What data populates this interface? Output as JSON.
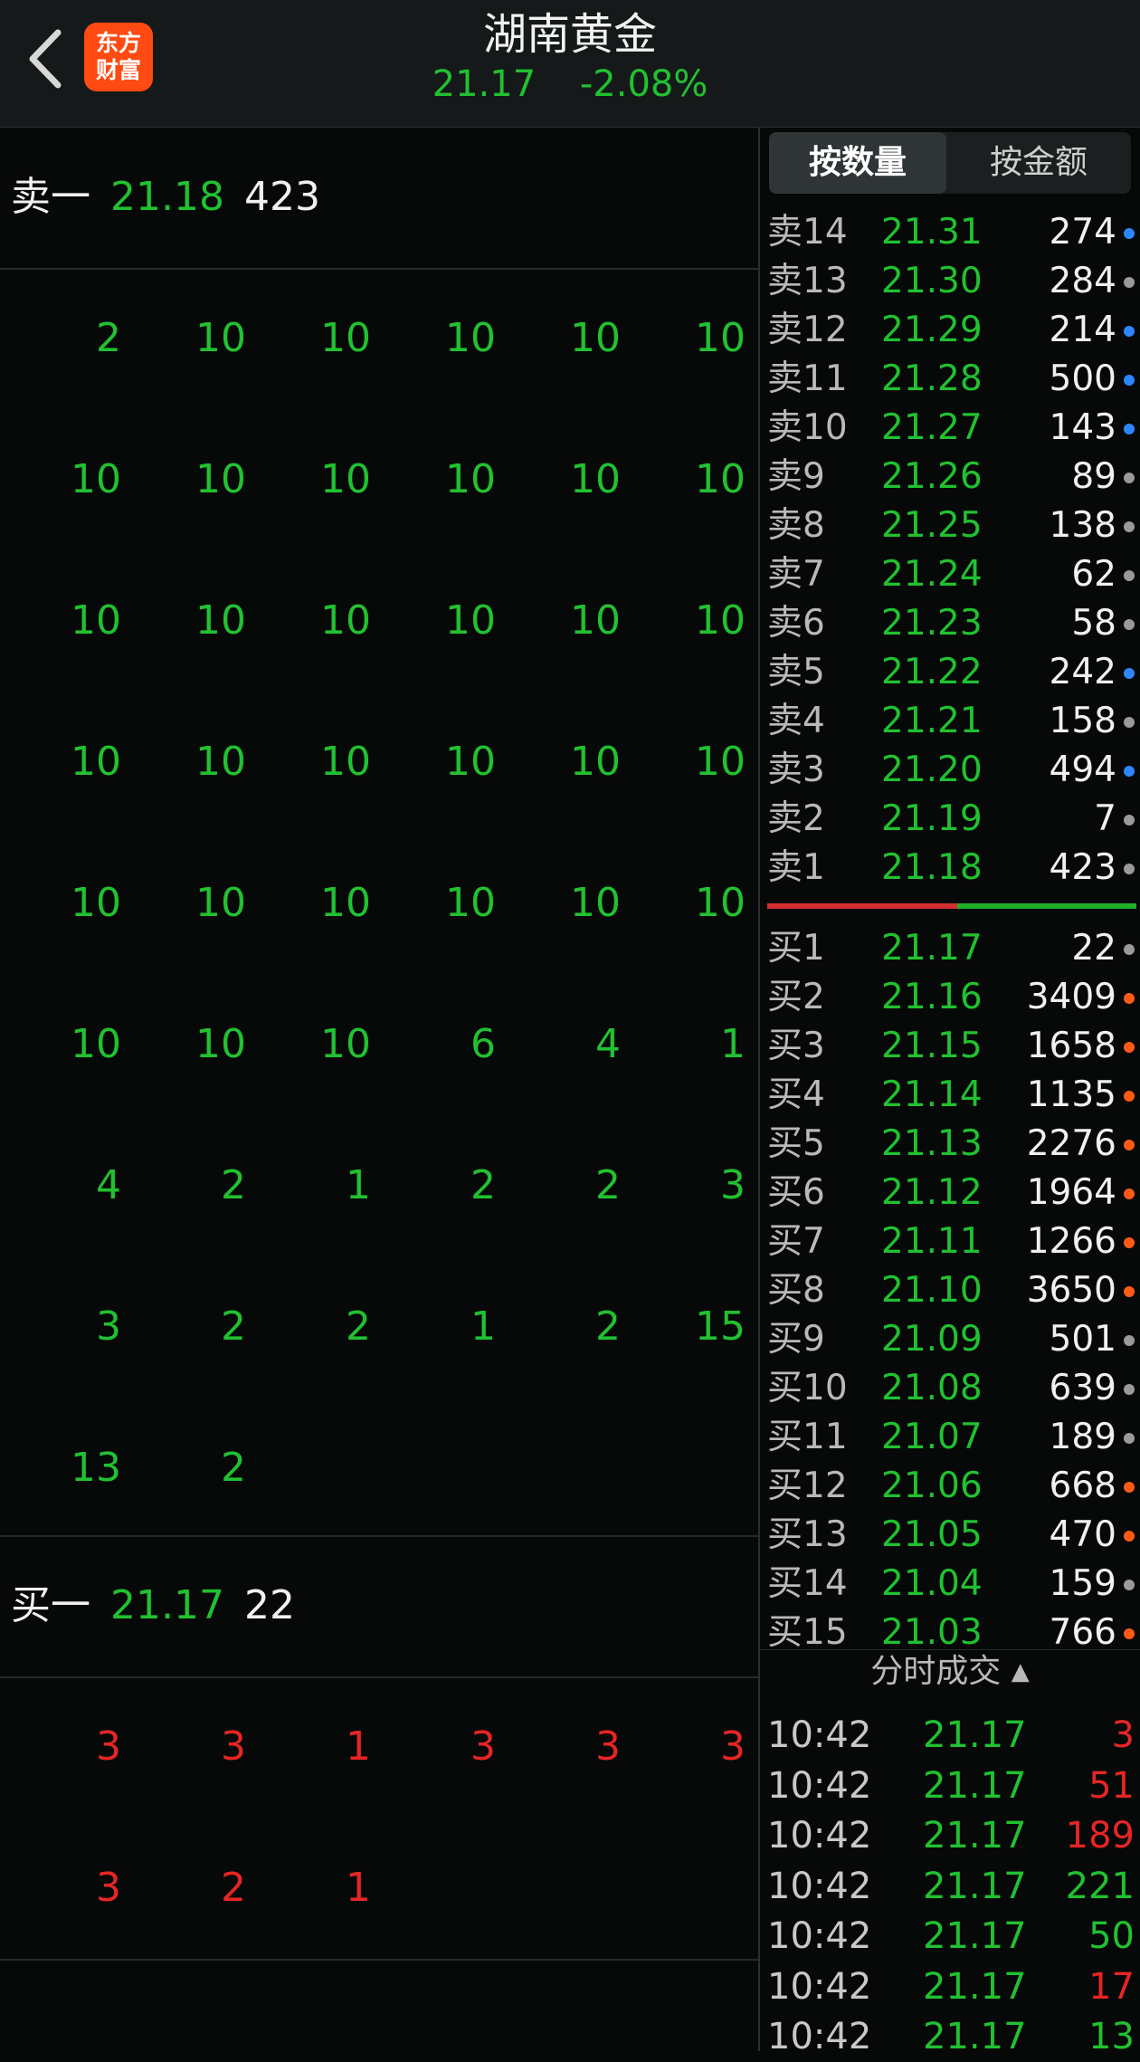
{
  "header": {
    "title": "湖南黄金",
    "price": "21.17",
    "change": "-2.08%",
    "logo_line1": "东方",
    "logo_line2": "财富"
  },
  "left_panel": {
    "ask1": {
      "label": "卖一",
      "price": "21.18",
      "qty": "423"
    },
    "bid1": {
      "label": "买一",
      "price": "21.17",
      "qty": "22"
    },
    "ask_queue": [
      [
        "2",
        "10",
        "10",
        "10",
        "10",
        "10"
      ],
      [
        "10",
        "10",
        "10",
        "10",
        "10",
        "10"
      ],
      [
        "10",
        "10",
        "10",
        "10",
        "10",
        "10"
      ],
      [
        "10",
        "10",
        "10",
        "10",
        "10",
        "10"
      ],
      [
        "10",
        "10",
        "10",
        "10",
        "10",
        "10"
      ],
      [
        "10",
        "10",
        "10",
        "6",
        "4",
        "1"
      ],
      [
        "4",
        "2",
        "1",
        "2",
        "2",
        "3"
      ],
      [
        "3",
        "2",
        "2",
        "1",
        "2",
        "15"
      ],
      [
        "13",
        "2"
      ]
    ],
    "bid_queue": [
      [
        "3",
        "3",
        "1",
        "3",
        "3",
        "3"
      ],
      [
        "3",
        "2",
        "1"
      ]
    ]
  },
  "right_panel": {
    "tabs": {
      "by_quantity": "按数量",
      "by_amount": "按金额"
    },
    "asks": [
      {
        "label": "卖14",
        "price": "21.31",
        "vol": "274",
        "dot": "blue"
      },
      {
        "label": "卖13",
        "price": "21.30",
        "vol": "284",
        "dot": "gray"
      },
      {
        "label": "卖12",
        "price": "21.29",
        "vol": "214",
        "dot": "blue"
      },
      {
        "label": "卖11",
        "price": "21.28",
        "vol": "500",
        "dot": "blue"
      },
      {
        "label": "卖10",
        "price": "21.27",
        "vol": "143",
        "dot": "blue"
      },
      {
        "label": "卖9",
        "price": "21.26",
        "vol": "89",
        "dot": "gray"
      },
      {
        "label": "卖8",
        "price": "21.25",
        "vol": "138",
        "dot": "gray"
      },
      {
        "label": "卖7",
        "price": "21.24",
        "vol": "62",
        "dot": "gray"
      },
      {
        "label": "卖6",
        "price": "21.23",
        "vol": "58",
        "dot": "gray"
      },
      {
        "label": "卖5",
        "price": "21.22",
        "vol": "242",
        "dot": "blue"
      },
      {
        "label": "卖4",
        "price": "21.21",
        "vol": "158",
        "dot": "gray"
      },
      {
        "label": "卖3",
        "price": "21.20",
        "vol": "494",
        "dot": "blue"
      },
      {
        "label": "卖2",
        "price": "21.19",
        "vol": "7",
        "dot": "gray"
      },
      {
        "label": "卖1",
        "price": "21.18",
        "vol": "423",
        "dot": "gray"
      }
    ],
    "bids": [
      {
        "label": "买1",
        "price": "21.17",
        "vol": "22",
        "dot": "gray"
      },
      {
        "label": "买2",
        "price": "21.16",
        "vol": "3409",
        "dot": "orange"
      },
      {
        "label": "买3",
        "price": "21.15",
        "vol": "1658",
        "dot": "orange"
      },
      {
        "label": "买4",
        "price": "21.14",
        "vol": "1135",
        "dot": "orange"
      },
      {
        "label": "买5",
        "price": "21.13",
        "vol": "2276",
        "dot": "orange"
      },
      {
        "label": "买6",
        "price": "21.12",
        "vol": "1964",
        "dot": "orange"
      },
      {
        "label": "买7",
        "price": "21.11",
        "vol": "1266",
        "dot": "orange"
      },
      {
        "label": "买8",
        "price": "21.10",
        "vol": "3650",
        "dot": "orange"
      },
      {
        "label": "买9",
        "price": "21.09",
        "vol": "501",
        "dot": "gray"
      },
      {
        "label": "买10",
        "price": "21.08",
        "vol": "639",
        "dot": "gray"
      },
      {
        "label": "买11",
        "price": "21.07",
        "vol": "189",
        "dot": "gray"
      },
      {
        "label": "买12",
        "price": "21.06",
        "vol": "668",
        "dot": "orange"
      },
      {
        "label": "买13",
        "price": "21.05",
        "vol": "470",
        "dot": "orange"
      },
      {
        "label": "买14",
        "price": "21.04",
        "vol": "159",
        "dot": "gray"
      },
      {
        "label": "买15",
        "price": "21.03",
        "vol": "766",
        "dot": "orange"
      }
    ],
    "ticks_header": "分时成交",
    "ticks": [
      {
        "time": "10:42",
        "price": "21.17",
        "vol": "3",
        "color": "red"
      },
      {
        "time": "10:42",
        "price": "21.17",
        "vol": "51",
        "color": "red"
      },
      {
        "time": "10:42",
        "price": "21.17",
        "vol": "189",
        "color": "red"
      },
      {
        "time": "10:42",
        "price": "21.17",
        "vol": "221",
        "color": "green"
      },
      {
        "time": "10:42",
        "price": "21.17",
        "vol": "50",
        "color": "green"
      },
      {
        "time": "10:42",
        "price": "21.17",
        "vol": "17",
        "color": "red"
      },
      {
        "time": "10:42",
        "price": "21.17",
        "vol": "13",
        "color": "green"
      }
    ]
  },
  "colors": {
    "up_red": "#e62525",
    "down_green": "#21c130",
    "dot_blue": "#2e86ff",
    "dot_gray": "#9a9a9a",
    "dot_orange": "#ff5a17"
  }
}
